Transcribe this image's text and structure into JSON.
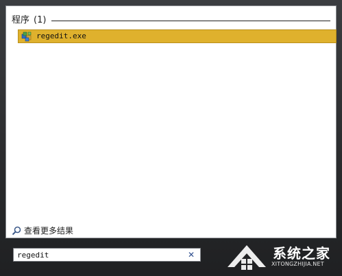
{
  "results": {
    "section_title": "程序",
    "section_count": "(1)",
    "items": [
      {
        "label": "regedit.exe",
        "icon": "registry-editor-icon",
        "selected": true
      }
    ],
    "highlight_color": "#dfb12d"
  },
  "see_more": {
    "label": "查看更多结果",
    "icon": "search-icon"
  },
  "search": {
    "value": "regedit",
    "clear_icon": "close-icon",
    "clear_glyph": "✕"
  },
  "watermark": {
    "title": "系统之家",
    "subtitle": "XITONGZHIJIA.NET"
  }
}
